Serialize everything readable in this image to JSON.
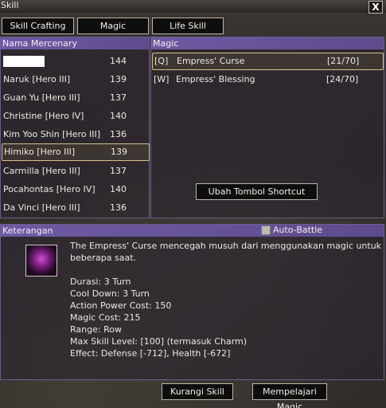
{
  "window": {
    "title": "Skill",
    "close_label": "X"
  },
  "tabs": [
    {
      "label": "Skill Crafting"
    },
    {
      "label": "Magic"
    },
    {
      "label": "Life Skill"
    }
  ],
  "mercenary_panel": {
    "header": "Nama Mercenary",
    "items": [
      {
        "name": "",
        "level": "144"
      },
      {
        "name": "Naruk [Hero III]",
        "level": "139"
      },
      {
        "name": "Guan Yu [Hero III]",
        "level": "137"
      },
      {
        "name": "Christine [Hero IV]",
        "level": "140"
      },
      {
        "name": "Kim Yoo Shin [Hero III]",
        "level": "136"
      },
      {
        "name": "Himiko [Hero III]",
        "level": "139"
      },
      {
        "name": "Carmilla [Hero III]",
        "level": "137"
      },
      {
        "name": "Pocahontas [Hero IV]",
        "level": "140"
      },
      {
        "name": "Da Vinci [Hero III]",
        "level": "136"
      }
    ]
  },
  "magic_panel": {
    "header": "Magic",
    "items": [
      {
        "key": "[Q]",
        "name": "Empress' Curse",
        "count": "[21/70]"
      },
      {
        "key": "[W]",
        "name": "Empress' Blessing",
        "count": "[24/70]"
      }
    ],
    "shortcut_button": "Ubah Tombol Shortcut"
  },
  "description_panel": {
    "header": "Keterangan",
    "auto_battle_label": "Auto-Battle",
    "icon": "empress-curse-skill-icon",
    "lines": [
      "The Empress' Curse mencegah musuh dari menggunakan magic untuk",
      "beberapa saat.",
      "Durasi: 3 Turn",
      "Cool Down: 3 Turn",
      "Action Power Cost: 150",
      "Magic Cost: 215",
      "Range: Row",
      "Max Skill Level: [100] (termasuk Charm)",
      "Effect: Defense [-712], Health [-672]"
    ]
  },
  "footer": {
    "reduce_button": "Kurangi Skill",
    "learn_button": "Mempelajari Magic"
  }
}
